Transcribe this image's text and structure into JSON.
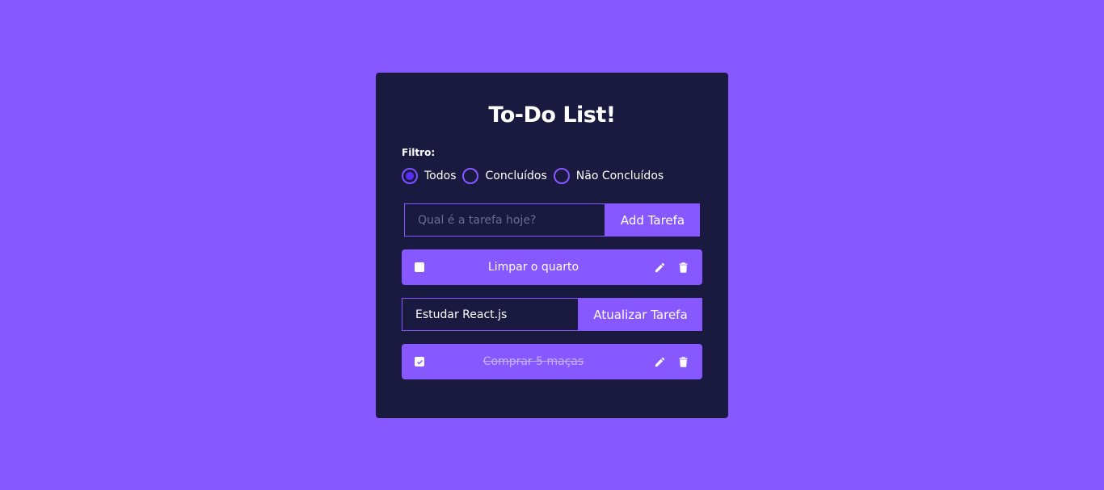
{
  "app": {
    "title": "To-Do List!"
  },
  "filter": {
    "label": "Filtro:",
    "options": [
      {
        "label": "Todos",
        "selected": true
      },
      {
        "label": "Concluídos",
        "selected": false
      },
      {
        "label": "Não Concluídos",
        "selected": false
      }
    ]
  },
  "add_form": {
    "placeholder": "Qual é a tarefa hoje?",
    "value": "",
    "button_label": "Add Tarefa"
  },
  "todos": [
    {
      "text": "Limpar o quarto",
      "completed": false,
      "editing": false
    },
    {
      "text": "Estudar React.js",
      "completed": false,
      "editing": true
    },
    {
      "text": "Comprar 5 maças",
      "completed": true,
      "editing": false
    }
  ],
  "edit_form": {
    "value": "Estudar React.js",
    "button_label": "Atualizar Tarefa"
  },
  "colors": {
    "background": "#8758ff",
    "card": "#1a1a40",
    "accent": "#8758ff",
    "radio_selected": "#5a2dff"
  },
  "icons": {
    "edit": "pencil-icon",
    "delete": "trash-icon",
    "checked": "check-icon"
  }
}
